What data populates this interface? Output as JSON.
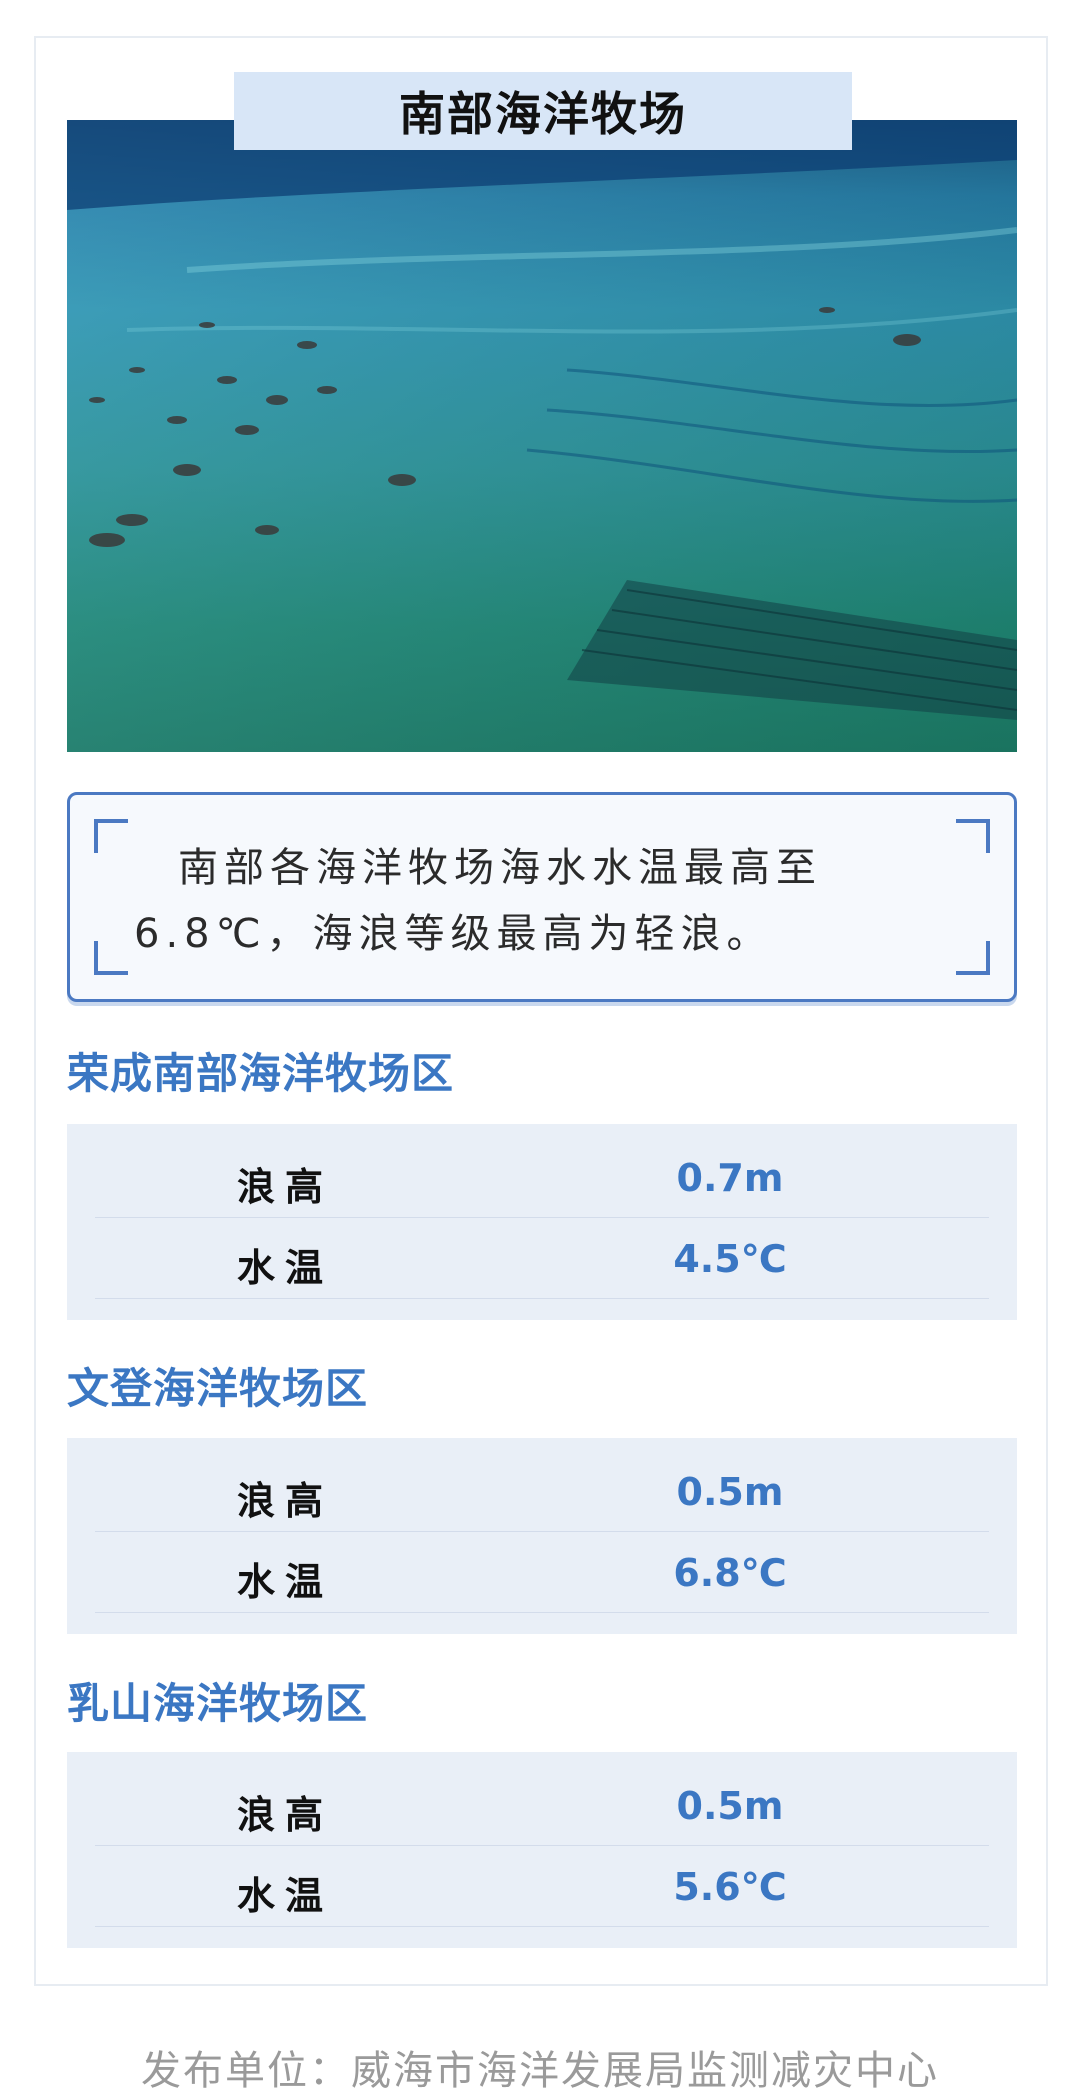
{
  "title": "南部海洋牧场",
  "summary": {
    "text": "南部各海洋牧场海水水温最高至6.8℃，海浪等级最高为轻浪。"
  },
  "areas": [
    {
      "name": "荣成南部海洋牧场区",
      "rows": [
        {
          "label": "浪高",
          "value": "0.7m"
        },
        {
          "label": "水温",
          "value": "4.5℃"
        }
      ]
    },
    {
      "name": "文登海洋牧场区",
      "rows": [
        {
          "label": "浪高",
          "value": "0.5m"
        },
        {
          "label": "水温",
          "value": "6.8℃"
        }
      ]
    },
    {
      "name": "乳山海洋牧场区",
      "rows": [
        {
          "label": "浪高",
          "value": "0.5m"
        },
        {
          "label": "水温",
          "value": "5.6℃"
        }
      ]
    }
  ],
  "footer": "发布单位：威海市海洋发展局监测减灾中心",
  "colors": {
    "accent": "#3b77c3",
    "banner": "#d8e6f7",
    "table_bg": "#e9eff7"
  }
}
